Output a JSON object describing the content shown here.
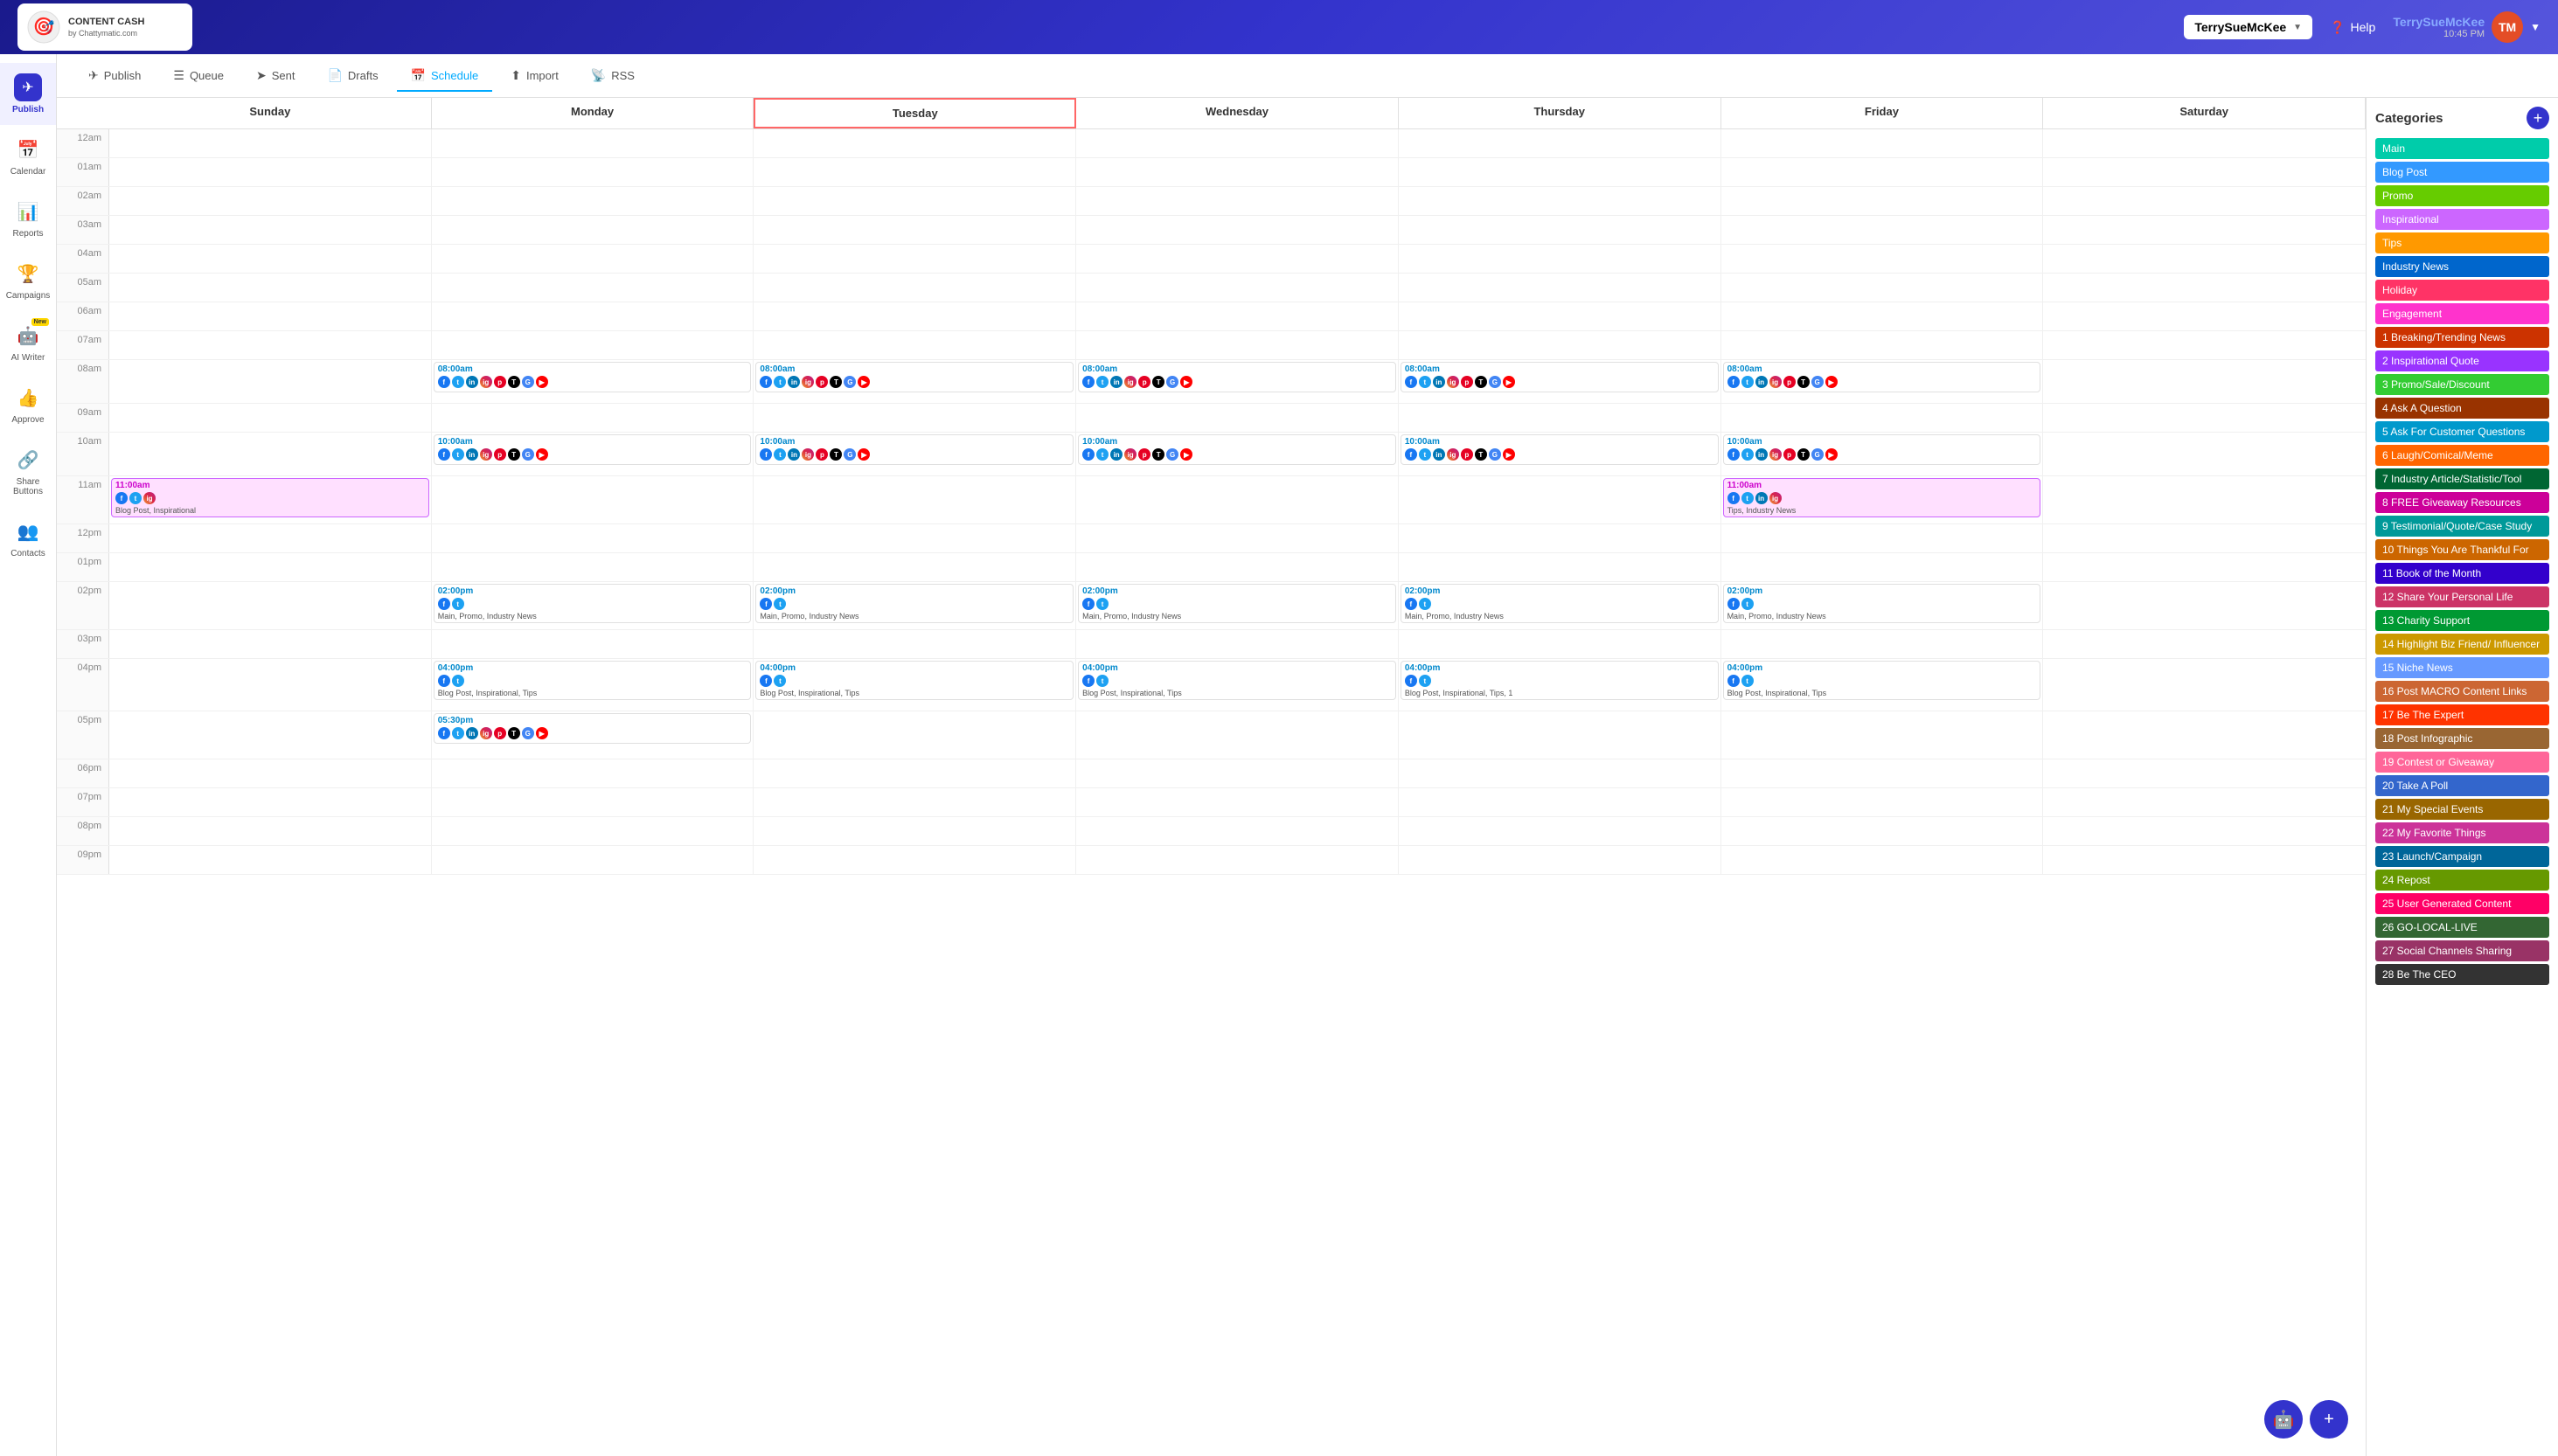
{
  "header": {
    "logo_line1": "CONTENT CASH",
    "logo_line2": "by Chattymatic.com",
    "account_name": "TerrySueMcKee",
    "help_label": "Help",
    "user_display_name": "TerrySueMcKee",
    "user_time": "10:45 PM",
    "user_initials": "TM"
  },
  "tabs": [
    {
      "id": "publish",
      "label": "Publish",
      "icon": "✈"
    },
    {
      "id": "queue",
      "label": "Queue",
      "icon": "☰"
    },
    {
      "id": "sent",
      "label": "Sent",
      "icon": "➤"
    },
    {
      "id": "drafts",
      "label": "Drafts",
      "icon": "📄"
    },
    {
      "id": "schedule",
      "label": "Schedule",
      "icon": "📅",
      "active": true
    },
    {
      "id": "import",
      "label": "Import",
      "icon": "⬆"
    },
    {
      "id": "rss",
      "label": "RSS",
      "icon": "📡"
    }
  ],
  "sidebar": {
    "items": [
      {
        "id": "publish",
        "label": "Publish",
        "icon": "✈",
        "active": true
      },
      {
        "id": "calendar",
        "label": "Calendar",
        "icon": "📅"
      },
      {
        "id": "reports",
        "label": "Reports",
        "icon": "📊"
      },
      {
        "id": "campaigns",
        "label": "Campaigns",
        "icon": "🏆"
      },
      {
        "id": "ai-writer",
        "label": "AI Writer",
        "icon": "🤖",
        "new": true
      },
      {
        "id": "approve",
        "label": "Approve",
        "icon": "👍"
      },
      {
        "id": "share-buttons",
        "label": "Share Buttons",
        "icon": "🔗"
      },
      {
        "id": "contacts",
        "label": "Contacts",
        "icon": "👥"
      }
    ]
  },
  "calendar": {
    "days": [
      "Sunday",
      "Monday",
      "Tuesday",
      "Wednesday",
      "Thursday",
      "Friday",
      "Saturday"
    ],
    "today_index": 2,
    "times": [
      "12am",
      "01am",
      "02am",
      "03am",
      "04am",
      "05am",
      "06am",
      "07am",
      "08am",
      "09am",
      "10am",
      "11am",
      "12pm",
      "01pm",
      "02pm",
      "03pm",
      "04pm",
      "05pm",
      "06pm",
      "07pm",
      "08pm",
      "09pm"
    ],
    "events": {
      "08am": {
        "monday": {
          "time": "08:00am",
          "categories": "",
          "icons": [
            "fb",
            "tw",
            "li",
            "ig",
            "pi",
            "tt",
            "gm",
            "yt"
          ]
        },
        "tuesday": {
          "time": "08:00am",
          "categories": "",
          "icons": [
            "fb",
            "tw",
            "li",
            "ig",
            "pi",
            "tt",
            "gm",
            "yt"
          ]
        },
        "wednesday": {
          "time": "08:00am",
          "categories": "",
          "icons": [
            "fb",
            "tw",
            "li",
            "ig",
            "pi",
            "tt",
            "gm",
            "yt"
          ]
        },
        "thursday": {
          "time": "08:00am",
          "categories": "",
          "icons": [
            "fb",
            "tw",
            "li",
            "ig",
            "pi",
            "tt",
            "gm",
            "yt"
          ]
        },
        "friday": {
          "time": "08:00am",
          "categories": "",
          "icons": [
            "fb",
            "tw",
            "li",
            "ig",
            "pi",
            "tt",
            "gm",
            "yt"
          ]
        }
      },
      "10am": {
        "monday": {
          "time": "10:00am",
          "categories": "",
          "icons": [
            "fb",
            "tw",
            "li",
            "ig",
            "pi",
            "tt",
            "gm",
            "yt"
          ]
        },
        "tuesday": {
          "time": "10:00am",
          "categories": "",
          "icons": [
            "fb",
            "tw",
            "li",
            "ig",
            "pi",
            "tt",
            "gm",
            "yt"
          ]
        },
        "wednesday": {
          "time": "10:00am",
          "categories": "",
          "icons": [
            "fb",
            "tw",
            "li",
            "ig",
            "pi",
            "tt",
            "gm",
            "yt"
          ]
        },
        "thursday": {
          "time": "10:00am",
          "categories": "",
          "icons": [
            "fb",
            "tw",
            "li",
            "ig",
            "pi",
            "tt",
            "gm",
            "yt"
          ]
        },
        "friday": {
          "time": "10:00am",
          "categories": "",
          "icons": [
            "fb",
            "tw",
            "li",
            "ig",
            "pi",
            "tt",
            "gm",
            "yt"
          ]
        }
      },
      "11am": {
        "sunday": {
          "time": "11:00am",
          "categories": "Blog Post, Inspirational",
          "icons": [
            "fb",
            "tw",
            "ig"
          ]
        },
        "friday": {
          "time": "11:00am",
          "categories": "Tips, Industry News",
          "icons": [
            "fb",
            "tw",
            "li",
            "ig"
          ]
        }
      },
      "02pm": {
        "monday": {
          "time": "02:00pm",
          "categories": "Main, Promo, Industry News",
          "icons": [
            "fb",
            "tw"
          ]
        },
        "tuesday": {
          "time": "02:00pm",
          "categories": "Main, Promo, Industry News",
          "icons": [
            "fb",
            "tw"
          ]
        },
        "wednesday": {
          "time": "02:00pm",
          "categories": "Main, Promo, Industry News",
          "icons": [
            "fb",
            "tw"
          ]
        },
        "thursday": {
          "time": "02:00pm",
          "categories": "Main, Promo, Industry News",
          "icons": [
            "fb",
            "tw"
          ]
        },
        "friday": {
          "time": "02:00pm",
          "categories": "Main, Promo, Industry News",
          "icons": [
            "fb",
            "tw"
          ]
        }
      },
      "04pm": {
        "monday": {
          "time": "04:00pm",
          "categories": "Blog Post, Inspirational, Tips",
          "icons": [
            "fb",
            "tw"
          ]
        },
        "tuesday": {
          "time": "04:00pm",
          "categories": "Blog Post, Inspirational, Tips",
          "icons": [
            "fb",
            "tw"
          ]
        },
        "wednesday": {
          "time": "04:00pm",
          "categories": "Blog Post, Inspirational, Tips",
          "icons": [
            "fb",
            "tw"
          ]
        },
        "thursday": {
          "time": "04:00pm",
          "categories": "Blog Post, Inspirational, Tips, 1",
          "icons": [
            "fb",
            "tw"
          ]
        },
        "friday": {
          "time": "04:00pm",
          "categories": "Blog Post, Inspirational, Tips",
          "icons": [
            "fb",
            "tw"
          ]
        }
      },
      "05pm": {
        "monday": {
          "time": "05:30pm",
          "categories": "",
          "icons": [
            "fb",
            "tw",
            "li",
            "ig",
            "pi",
            "tt",
            "gm",
            "yt"
          ]
        }
      }
    }
  },
  "categories": {
    "title": "Categories",
    "add_label": "+",
    "items": [
      {
        "label": "Main",
        "class": "cat-main"
      },
      {
        "label": "Blog Post",
        "class": "cat-blogpost"
      },
      {
        "label": "Promo",
        "class": "cat-promo"
      },
      {
        "label": "Inspirational",
        "class": "cat-inspirational"
      },
      {
        "label": "Tips",
        "class": "cat-tips"
      },
      {
        "label": "Industry News",
        "class": "cat-industry"
      },
      {
        "label": "Holiday",
        "class": "cat-holiday"
      },
      {
        "label": "Engagement",
        "class": "cat-engagement"
      },
      {
        "label": "1 Breaking/Trending News",
        "class": "cat-breaking"
      },
      {
        "label": "2 Inspirational Quote",
        "class": "cat-insp-quote"
      },
      {
        "label": "3 Promo/Sale/Discount",
        "class": "cat-promo-sale"
      },
      {
        "label": "4 Ask A Question",
        "class": "cat-ask-question"
      },
      {
        "label": "5 Ask For Customer Questions",
        "class": "cat-ask-customer"
      },
      {
        "label": "6 Laugh/Comical/Meme",
        "class": "cat-laugh"
      },
      {
        "label": "7 Industry Article/Statistic/Tool",
        "class": "cat-industry-article"
      },
      {
        "label": "8 FREE Giveaway Resources",
        "class": "cat-giveaway"
      },
      {
        "label": "9 Testimonial/Quote/Case Study",
        "class": "cat-testimonial"
      },
      {
        "label": "10 Things You Are Thankful For",
        "class": "cat-thankful"
      },
      {
        "label": "11 Book of the Month",
        "class": "cat-book"
      },
      {
        "label": "12 Share Your Personal Life",
        "class": "cat-share-personal"
      },
      {
        "label": "13 Charity Support",
        "class": "cat-charity"
      },
      {
        "label": "14 Highlight Biz Friend/ Influencer",
        "class": "cat-highlight"
      },
      {
        "label": "15 Niche News",
        "class": "cat-niche"
      },
      {
        "label": "16 Post MACRO Content Links",
        "class": "cat-macro"
      },
      {
        "label": "17 Be The Expert",
        "class": "cat-be-expert"
      },
      {
        "label": "18 Post Infographic",
        "class": "cat-post-info"
      },
      {
        "label": "19 Contest or Giveaway",
        "class": "cat-contest"
      },
      {
        "label": "20 Take A Poll",
        "class": "cat-take-poll"
      },
      {
        "label": "21 My Special Events",
        "class": "cat-special"
      },
      {
        "label": "22 My Favorite Things",
        "class": "cat-favorite"
      },
      {
        "label": "23 Launch/Campaign",
        "class": "cat-launch"
      },
      {
        "label": "24 Repost",
        "class": "cat-repost"
      },
      {
        "label": "25 User Generated Content",
        "class": "cat-user-gen"
      },
      {
        "label": "26 GO-LOCAL-LIVE",
        "class": "cat-go-local"
      },
      {
        "label": "27 Social Channels Sharing",
        "class": "cat-social-channels"
      },
      {
        "label": "28 Be The CEO",
        "class": "cat-be-ceo"
      }
    ]
  }
}
